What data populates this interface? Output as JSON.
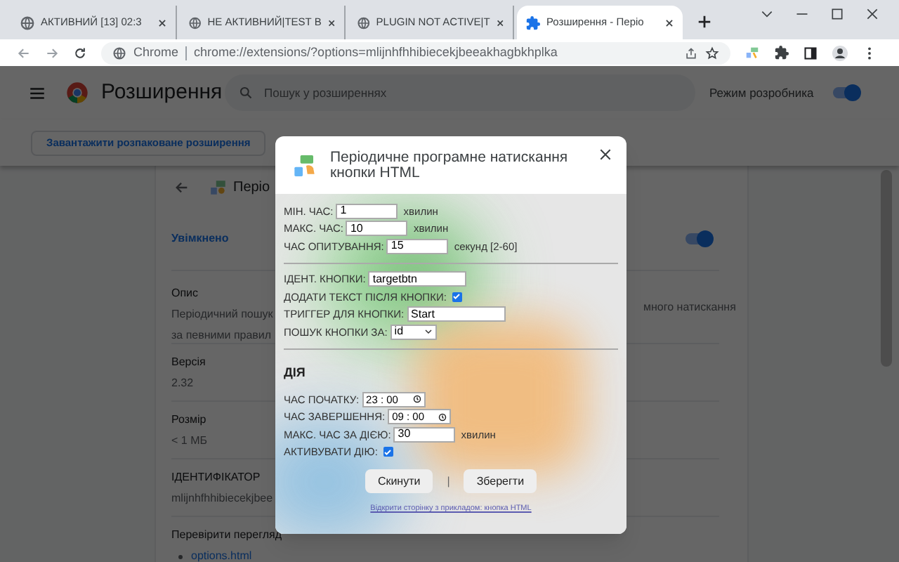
{
  "browser": {
    "tabs": [
      {
        "title": "АКТИВНИЙ [13] 02:3",
        "kind": "globe",
        "selected": false
      },
      {
        "title": "НЕ АКТИВНИЙ|TEST B",
        "kind": "globe",
        "selected": false
      },
      {
        "title": "PLUGIN NOT ACTIVE|T",
        "kind": "globe",
        "selected": false
      },
      {
        "title": "Розширення - Періо",
        "kind": "puzzle",
        "selected": true
      }
    ],
    "address": {
      "chip": "Chrome",
      "url": "chrome://extensions/?options=mlijnhfhhibiecekjbeeakhagbkhplka"
    }
  },
  "page": {
    "title": "Розширення",
    "search": {
      "placeholder": "Пошук у розширеннях"
    },
    "dev_mode": {
      "label": "Режим розробника",
      "on": true
    },
    "load_button": "Завантажити розпаковане розширення",
    "detail": {
      "name": "Періо",
      "status": {
        "label": "Увімкнено",
        "on": true
      },
      "sections": [
        {
          "label": "Опис",
          "lines": [
            "Періодичний пошук",
            "за певними правил"
          ],
          "right": "много натискання"
        },
        {
          "label": "Версія",
          "lines": [
            "2.32"
          ]
        },
        {
          "label": "Розмір",
          "lines": [
            "< 1 МБ"
          ]
        },
        {
          "label": "ІДЕНТИФІКАТОР",
          "lines": [
            "mlijnhfhhibiecekjbee"
          ]
        },
        {
          "label": "Перевірити перегляд",
          "links": [
            "options.html"
          ]
        }
      ]
    }
  },
  "modal": {
    "title": "Періодичне програмне натискання кнопки HTML",
    "groups": [
      {
        "fields": [
          {
            "kind": "text",
            "label": "МІН. ЧАС:",
            "value": "1",
            "unit": "хвилин"
          },
          {
            "kind": "text",
            "label": "МАКС. ЧАС:",
            "value": "10",
            "unit": "хвилин"
          },
          {
            "kind": "text",
            "label": "ЧАС ОПИТУВАННЯ:",
            "value": "15",
            "unit": "секунд [2-60]"
          }
        ]
      },
      {
        "fields": [
          {
            "kind": "text",
            "label": "ІДЕНТ. КНОПКИ:",
            "value": "targetbtn",
            "wide": true
          },
          {
            "kind": "check",
            "label": "ДОДАТИ ТЕКСТ ПІСЛЯ КНОПКИ:",
            "checked": true
          },
          {
            "kind": "text",
            "label": "ТРИГГЕР ДЛЯ КНОПКИ:",
            "value": "Start",
            "wide": true
          },
          {
            "kind": "select",
            "label": "ПОШУК КНОПКИ ЗА:",
            "value": "id"
          }
        ]
      },
      {
        "heading": "ДІЯ",
        "fields": [
          {
            "kind": "time",
            "label": "ЧАС ПОЧАТКУ:",
            "value": "23 : 00"
          },
          {
            "kind": "time",
            "label": "ЧАС ЗАВЕРШЕННЯ:",
            "value": "09 : 00"
          },
          {
            "kind": "text",
            "label": "МАКС. ЧАС ЗА ДІЄЮ:",
            "value": "30",
            "unit": "хвилин"
          },
          {
            "kind": "check",
            "label": "АКТИВУВАТИ ДІЮ:",
            "checked": true
          }
        ]
      }
    ],
    "buttons": [
      "Скинути",
      "Зберегти"
    ],
    "separator": "|",
    "link": "Відкрити сторінку з прикладом: кнопка HTML"
  }
}
